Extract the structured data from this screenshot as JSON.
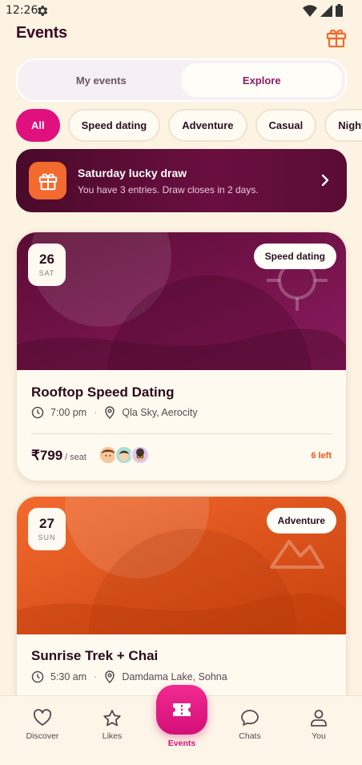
{
  "status": {
    "time": "12:26"
  },
  "header": {
    "title": "Events"
  },
  "segments": [
    {
      "label": "My events"
    },
    {
      "label": "Explore"
    }
  ],
  "filters": [
    {
      "label": "All"
    },
    {
      "label": "Speed dating"
    },
    {
      "label": "Adventure"
    },
    {
      "label": "Casual"
    },
    {
      "label": "Nightlife"
    }
  ],
  "promo": {
    "title": "Saturday lucky draw",
    "subtitle": "You have 3 entries. Draw closes in 2 days."
  },
  "events": [
    {
      "day": "26",
      "weekday": "SAT",
      "category": "Speed dating",
      "title": "Rooftop Speed Dating",
      "time": "7:00 pm",
      "venue": "Qla Sky, Aerocity",
      "price": "₹799",
      "per": "/ seat",
      "spots_left": "6 left",
      "colors": {
        "hero_start": "#5a0c34",
        "hero_end": "#8c1a60"
      }
    },
    {
      "day": "27",
      "weekday": "SUN",
      "category": "Adventure",
      "title": "Sunrise Trek + Chai",
      "time": "5:30 am",
      "venue": "Damdama Lake, Sohna",
      "colors": {
        "hero_start": "#f26a2e",
        "hero_end": "#c8400c"
      }
    }
  ],
  "nav": {
    "items": [
      {
        "label": "Discover",
        "icon": "heart-icon"
      },
      {
        "label": "Likes",
        "icon": "star-icon"
      },
      {
        "label": "Events",
        "icon": "ticket-icon"
      },
      {
        "label": "Chats",
        "icon": "chat-icon"
      },
      {
        "label": "You",
        "icon": "user-icon"
      }
    ]
  },
  "accent": "#e0107e"
}
